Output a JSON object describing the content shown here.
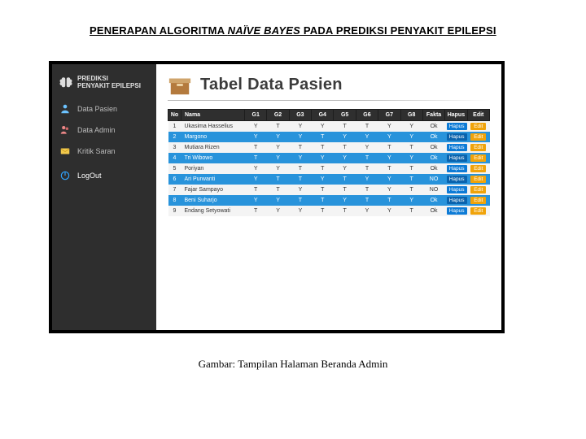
{
  "doc": {
    "title_prefix": "PENERAPAN ALGORITMA ",
    "title_italic": "NAÏVE BAYES",
    "title_suffix": " PADA PREDIKSI PENYAKIT EPILEPSI",
    "caption": "Gambar: Tampilan Halaman Beranda Admin"
  },
  "brand": {
    "line1": "PREDIKSI",
    "line2": "PENYAKIT EPILEPSI"
  },
  "sidebar": {
    "items": [
      {
        "label": "Data Pasien"
      },
      {
        "label": "Data Admin"
      },
      {
        "label": "Kritik Saran"
      },
      {
        "label": "LogOut"
      }
    ]
  },
  "content": {
    "title": "Tabel Data Pasien"
  },
  "table": {
    "headers": [
      "No",
      "Nama",
      "G1",
      "G2",
      "G3",
      "G4",
      "G5",
      "G6",
      "G7",
      "G8",
      "Fakta",
      "Hapus",
      "Edit"
    ],
    "rows": [
      {
        "no": "1",
        "name": "Ukasima Hasselius",
        "g": [
          "Y",
          "T",
          "Y",
          "Y",
          "T",
          "T",
          "Y",
          "Y"
        ],
        "fakta": "Ok"
      },
      {
        "no": "2",
        "name": "Margono",
        "g": [
          "Y",
          "Y",
          "Y",
          "T",
          "Y",
          "Y",
          "Y",
          "Y"
        ],
        "fakta": "Ok"
      },
      {
        "no": "3",
        "name": "Mutiara Rizen",
        "g": [
          "T",
          "Y",
          "T",
          "T",
          "T",
          "Y",
          "T",
          "T"
        ],
        "fakta": "Ok"
      },
      {
        "no": "4",
        "name": "Tri Wibowo",
        "g": [
          "T",
          "Y",
          "Y",
          "Y",
          "Y",
          "T",
          "Y",
          "Y"
        ],
        "fakta": "Ok"
      },
      {
        "no": "5",
        "name": "Poriyan",
        "g": [
          "Y",
          "Y",
          "T",
          "T",
          "Y",
          "T",
          "T",
          "T"
        ],
        "fakta": "Ok"
      },
      {
        "no": "6",
        "name": "Ari Purwanti",
        "g": [
          "Y",
          "T",
          "T",
          "Y",
          "T",
          "Y",
          "Y",
          "T"
        ],
        "fakta": "NO"
      },
      {
        "no": "7",
        "name": "Fajar Sampayo",
        "g": [
          "T",
          "T",
          "Y",
          "T",
          "T",
          "T",
          "Y",
          "T"
        ],
        "fakta": "NO"
      },
      {
        "no": "8",
        "name": "Beni Suharjo",
        "g": [
          "Y",
          "Y",
          "T",
          "T",
          "Y",
          "T",
          "T",
          "Y"
        ],
        "fakta": "Ok"
      },
      {
        "no": "9",
        "name": "Endang Setyowati",
        "g": [
          "T",
          "Y",
          "Y",
          "T",
          "T",
          "Y",
          "Y",
          "T"
        ],
        "fakta": "Ok"
      }
    ],
    "hapus_label": "Hapus",
    "edit_label": "Edit"
  }
}
